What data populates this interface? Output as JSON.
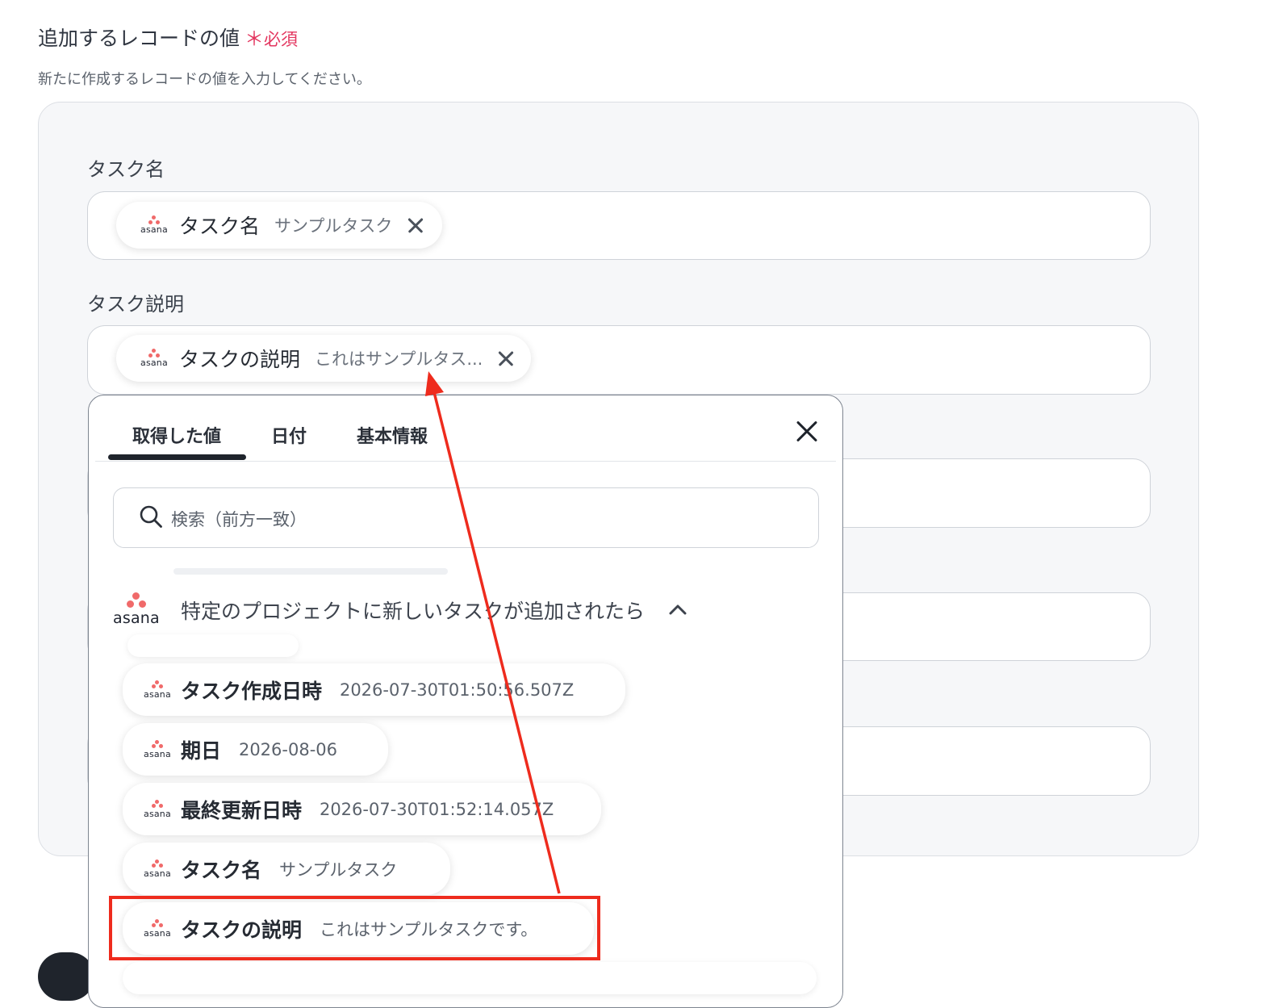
{
  "section": {
    "title": "追加するレコードの値",
    "required_mark": "＊",
    "required_label": "必須",
    "description": "新たに作成するレコードの値を入力してください。"
  },
  "fields": [
    {
      "label": "タスク名",
      "chip": {
        "app": "asana",
        "label": "タスク名",
        "value": "サンプルタスク"
      }
    },
    {
      "label": "タスク説明",
      "chip": {
        "app": "asana",
        "label": "タスクの説明",
        "value": "これはサンプルタス..."
      }
    }
  ],
  "popup": {
    "tabs": [
      {
        "label": "取得した値",
        "active": true
      },
      {
        "label": "日付",
        "active": false
      },
      {
        "label": "基本情報",
        "active": false
      }
    ],
    "search_placeholder": "検索（前方一致）",
    "group": {
      "app": "asana",
      "title": "特定のプロジェクトに新しいタスクが追加されたら",
      "expanded": true
    },
    "items": [
      {
        "label": "タスク作成日時",
        "value": "2026-07-30T01:50:56.507Z"
      },
      {
        "label": "期日",
        "value": "2026-08-06"
      },
      {
        "label": "最終更新日時",
        "value": "2026-07-30T01:52:14.057Z"
      },
      {
        "label": "タスク名",
        "value": "サンプルタスク"
      },
      {
        "label": "タスクの説明",
        "value": "これはサンプルタスクです。"
      }
    ]
  },
  "colors": {
    "required": "#e3365f",
    "asana_brand": "#f06a6a",
    "annotation": "#ee2b1d",
    "panel_bg": "#f6f7f9"
  }
}
